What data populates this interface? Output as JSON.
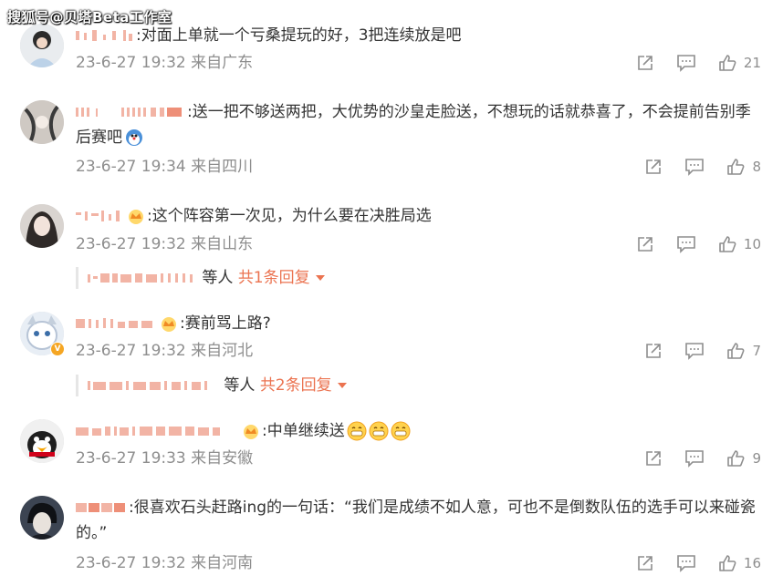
{
  "watermark": "搜狐号@贝塔Beta工作室",
  "comments": [
    {
      "text": ":对面上单就一个亏桑提玩的好，3把连续放是吧",
      "time": "23-6-27 19:32",
      "location": "来自广东",
      "likes": "21"
    },
    {
      "text": ":送一把不够送两把，大优势的沙皇走脸送，不想玩的话就恭喜了，不会提前告别季后赛吧",
      "time": "23-6-27 19:34",
      "location": "来自四川",
      "likes": "8"
    },
    {
      "text": ":这个阵容第一次见，为什么要在决胜局选",
      "time": "23-6-27 19:32",
      "location": "来自山东",
      "likes": "10",
      "reply": {
        "others": "等人",
        "more": "共1条回复"
      }
    },
    {
      "text": ":赛前骂上路?",
      "time": "23-6-27 19:32",
      "location": "来自河北",
      "likes": "7",
      "reply": {
        "others": "等人",
        "more": "共2条回复"
      }
    },
    {
      "text": ":中单继续送",
      "time": "23-6-27 19:33",
      "location": "来自安徽",
      "likes": "9"
    },
    {
      "text": ":很喜欢石头赶路ing的一句话：“我们是成绩不如人意，可也不是倒数队伍的选手可以来碰瓷的。”",
      "time": "23-6-27 19:32",
      "location": "来自河南",
      "likes": "16"
    }
  ],
  "icons": {
    "share": "share-icon",
    "comment": "comment-icon",
    "like": "thumbs-up-icon",
    "crown": "crown-badge-icon",
    "emoji": "grin-emoji-icon"
  },
  "colors": {
    "meta": "#8e8e8e",
    "link": "#eb7350",
    "text": "#333333"
  }
}
